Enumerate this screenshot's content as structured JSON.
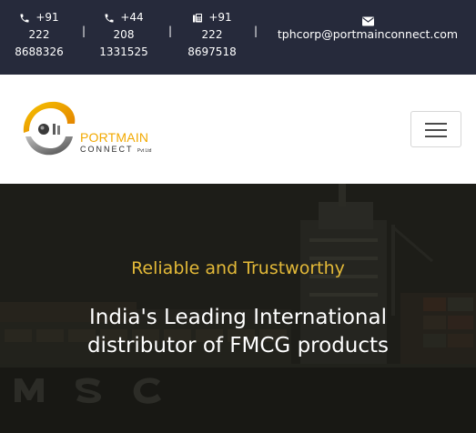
{
  "topbar": {
    "contacts": [
      {
        "icon": "phone-icon",
        "number": "+91\n222\n8688326",
        "line1": "+91",
        "line2": "222",
        "line3": "8688326"
      },
      {
        "icon": "phone-icon",
        "line1": "+44",
        "line2": "208",
        "line3": "1331525"
      },
      {
        "icon": "fax-icon",
        "line1": "+91",
        "line2": "222",
        "line3": "8697518"
      }
    ],
    "separator": "|",
    "email": {
      "icon": "envelope-icon",
      "address": "tphcorp@portmainconnect.com"
    }
  },
  "navbar": {
    "logo": {
      "title": "PORTMAIN",
      "subtitle": "CONNECT",
      "suffix": "Pvt Ltd"
    },
    "toggler": {
      "icon": "hamburger-menu-icon"
    }
  },
  "hero": {
    "tagline": "Reliable and Trustworthy",
    "headline": "India's Leading International distributor of FMCG products",
    "background_lettering": "MSC"
  },
  "colors": {
    "topbar_bg": "#262a3b",
    "tagline": "#e3b938",
    "logo_accent": "#f2a900"
  }
}
